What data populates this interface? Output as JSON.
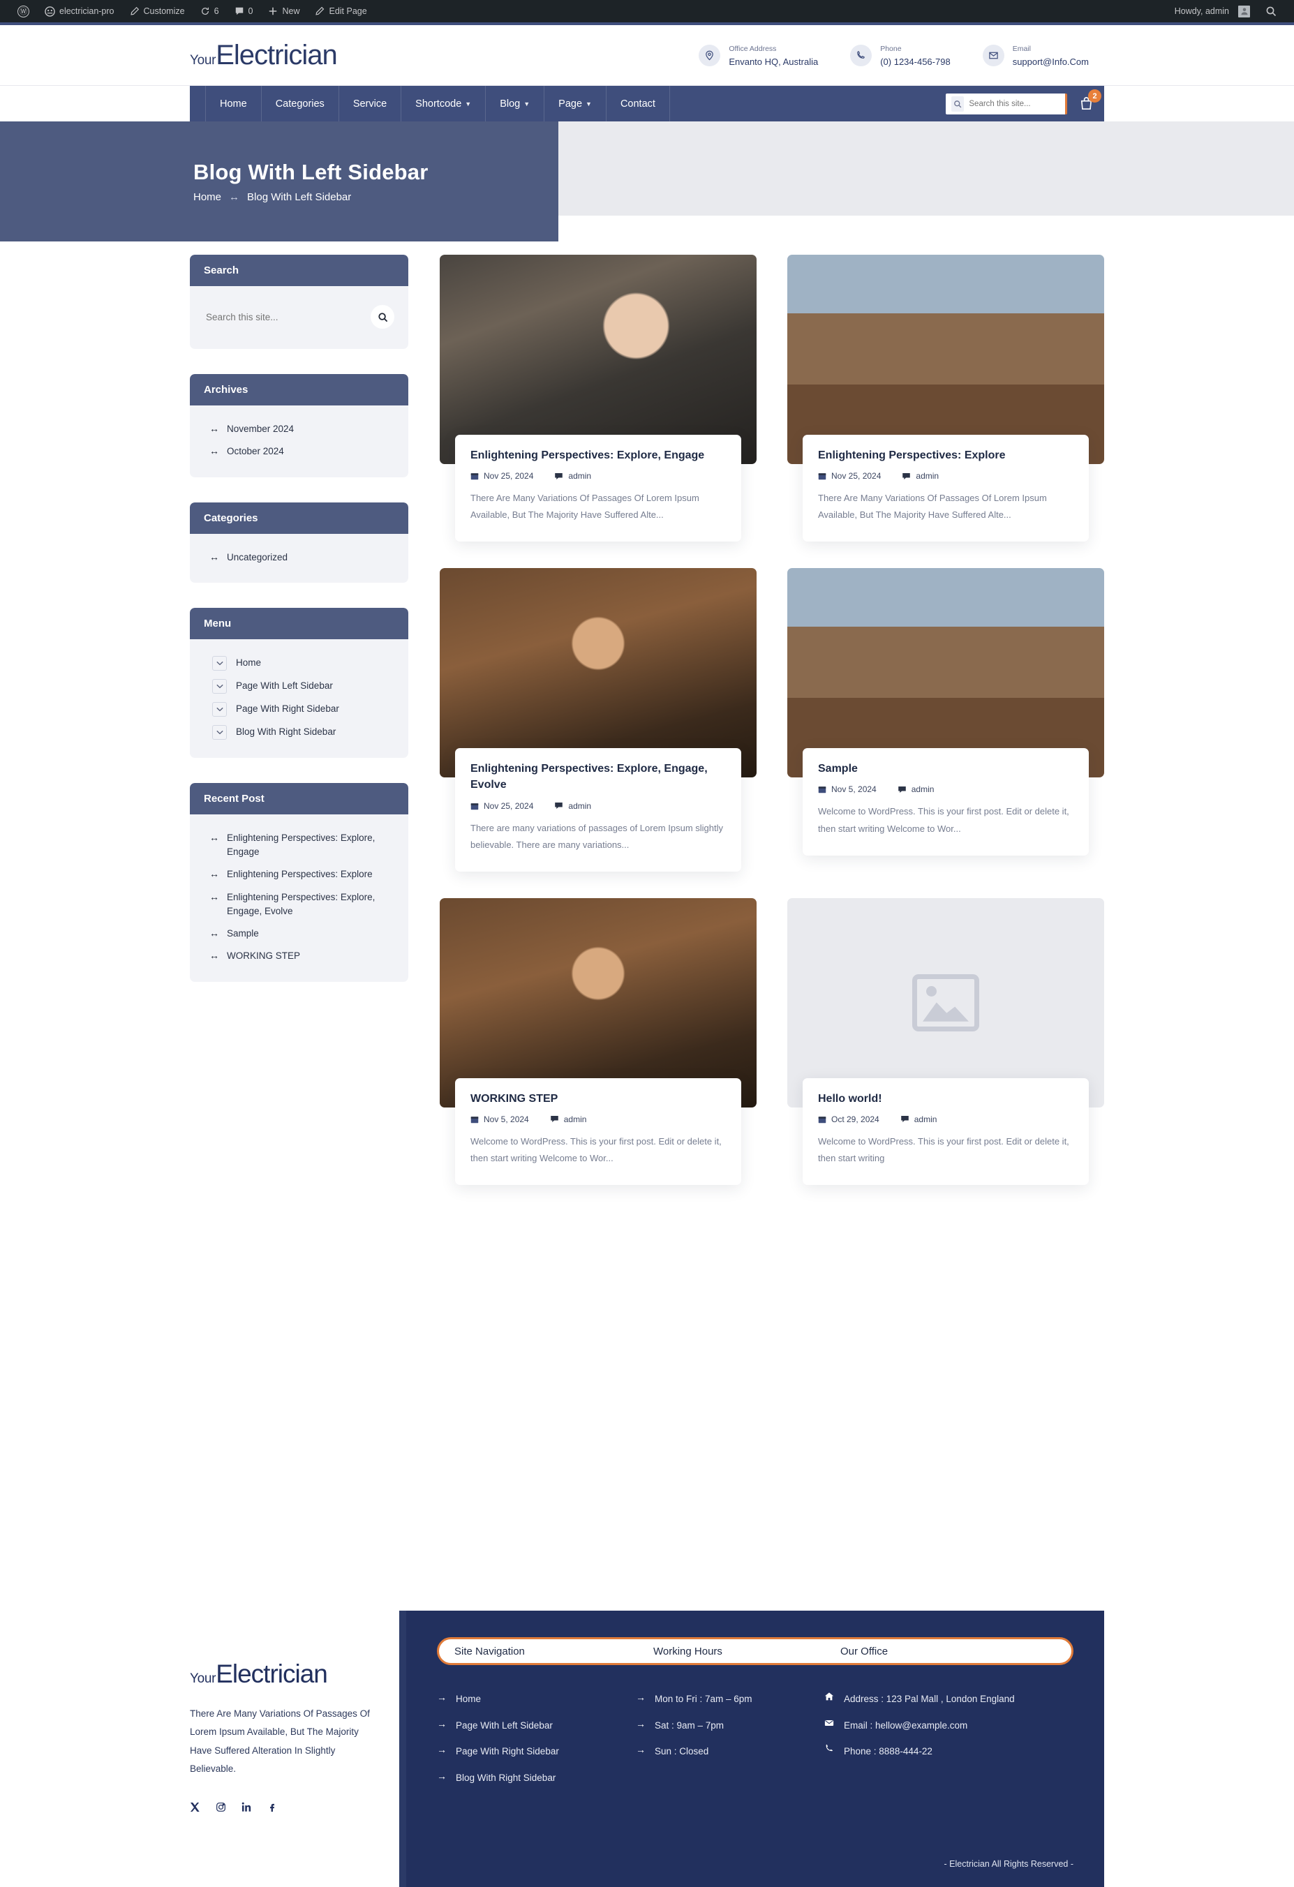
{
  "adminbar": {
    "wp_logo": "wordpress-logo-icon",
    "site_name": "electrician-pro",
    "customize": "Customize",
    "updates_count": "6",
    "comments_count": "0",
    "new": "New",
    "edit_page": "Edit Page",
    "howdy": "Howdy, admin",
    "search_icon": "search-icon"
  },
  "header": {
    "brand_prefix": "Your",
    "brand_name": "Electrician",
    "contacts": [
      {
        "label": "Office Address",
        "value": "Envanto HQ, Australia",
        "icon": "location-pin-icon"
      },
      {
        "label": "Phone",
        "value": "(0) 1234-456-798",
        "icon": "phone-icon"
      },
      {
        "label": "Email",
        "value": "support@Info.Com",
        "icon": "envelope-icon"
      }
    ]
  },
  "nav": {
    "items": [
      {
        "label": "Home",
        "has_caret": false
      },
      {
        "label": "Categories",
        "has_caret": false
      },
      {
        "label": "Service",
        "has_caret": false
      },
      {
        "label": "Shortcode",
        "has_caret": true
      },
      {
        "label": "Blog",
        "has_caret": true
      },
      {
        "label": "Page",
        "has_caret": true
      },
      {
        "label": "Contact",
        "has_caret": false
      }
    ],
    "search_placeholder": "Search this site...",
    "cart_count": "2"
  },
  "hero": {
    "title": "Blog With Left Sidebar",
    "crumb_home": "Home",
    "crumb_sep": "↔",
    "crumb_current": "Blog With Left Sidebar"
  },
  "sidebar": {
    "search": {
      "title": "Search",
      "placeholder": "Search this site...",
      "button_icon": "search-icon"
    },
    "archives": {
      "title": "Archives",
      "items": [
        "November 2024",
        "October 2024"
      ]
    },
    "categories": {
      "title": "Categories",
      "items": [
        "Uncategorized"
      ]
    },
    "menu": {
      "title": "Menu",
      "items": [
        "Home",
        "Page With Left Sidebar",
        "Page With Right Sidebar",
        "Blog With Right Sidebar"
      ]
    },
    "recent": {
      "title": "Recent Post",
      "items": [
        "Enlightening Perspectives: Explore, Engage",
        "Enlightening Perspectives: Explore",
        "Enlightening Perspectives: Explore, Engage, Evolve",
        "Sample",
        "WORKING STEP"
      ]
    }
  },
  "posts": [
    {
      "title": "Enlightening Perspectives: Explore, Engage",
      "date": "Nov 25, 2024",
      "author": "admin",
      "excerpt": "There Are Many Variations Of Passages Of Lorem Ipsum Available, But The Majority Have Suffered Alte...",
      "image": "img1"
    },
    {
      "title": "Enlightening Perspectives: Explore",
      "date": "Nov 25, 2024",
      "author": "admin",
      "excerpt": "There Are Many Variations Of Passages Of Lorem Ipsum Available, But The Majority Have Suffered Alte...",
      "image": "img2"
    },
    {
      "title": "Enlightening Perspectives: Explore, Engage, Evolve",
      "date": "Nov 25, 2024",
      "author": "admin",
      "excerpt": "There are many variations of passages of Lorem Ipsum slightly believable. There are many variations...",
      "image": "img3"
    },
    {
      "title": "Sample",
      "date": "Nov 5, 2024",
      "author": "admin",
      "excerpt": "Welcome to WordPress. This is your first post. Edit or delete it, then start writing Welcome to Wor...",
      "image": "img2"
    },
    {
      "title": "WORKING STEP",
      "date": "Nov 5, 2024",
      "author": "admin",
      "excerpt": "Welcome to WordPress. This is your first post. Edit or delete it, then start writing Welcome to Wor...",
      "image": "img3"
    },
    {
      "title": "Hello world!",
      "date": "Oct 29, 2024",
      "author": "admin",
      "excerpt": "Welcome to WordPress. This is your first post. Edit or delete it, then start writing",
      "image": "placeholder"
    }
  ],
  "footer": {
    "brand_prefix": "Your",
    "brand_name": "Electrician",
    "description": "There Are Many Variations Of Passages Of Lorem Ipsum Available, But The Majority Have Suffered Alteration In Slightly Believable.",
    "social": [
      "x-twitter-icon",
      "instagram-icon",
      "linkedin-icon",
      "facebook-icon"
    ],
    "tabs": [
      "Site Navigation",
      "Working Hours",
      "Our Office"
    ],
    "site_navigation": [
      "Home",
      "Page With Left Sidebar",
      "Page With Right Sidebar",
      "Blog With Right Sidebar"
    ],
    "working_hours": [
      "Mon to Fri : 7am – 6pm",
      "Sat : 9am – 7pm",
      "Sun : Closed"
    ],
    "our_office": [
      {
        "icon": "home-icon",
        "text": "Address : 123 Pal Mall , London England"
      },
      {
        "icon": "envelope-icon",
        "text": "Email : hellow@example.com"
      },
      {
        "icon": "phone-icon",
        "text": "Phone : 8888-444-22"
      }
    ],
    "copyright": "- Electrician All Rights Reserved -"
  },
  "colors": {
    "nav_blue": "#3f4e7c",
    "hero_blue": "#4e5b80",
    "footer_navy": "#22305e",
    "accent_orange": "#e07b39",
    "admin_dark": "#1d2327"
  }
}
